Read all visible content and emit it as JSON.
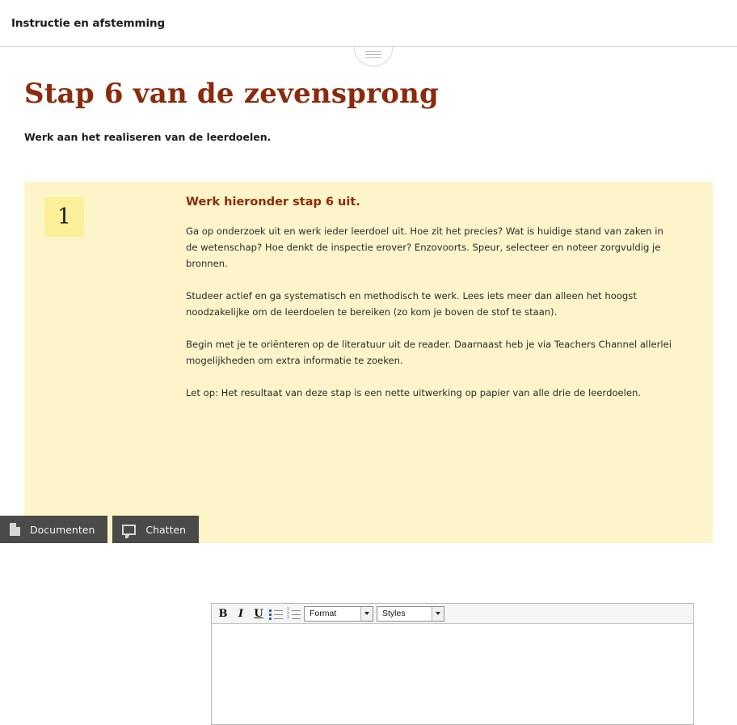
{
  "header": {
    "title": "Instructie en afstemming",
    "drag_handle_icon": "grip-lines-icon"
  },
  "page": {
    "title": "Stap 6 van de zevensprong",
    "subtitle": "Werk aan het realiseren van de leerdoelen."
  },
  "task_panel": {
    "number": "1",
    "heading": "Werk hieronder stap 6 uit.",
    "paragraphs": [
      "Ga op onderzoek uit en werk ieder leerdoel uit. Hoe zit het precies? Wat is huidige stand van zaken in de wetenschap? Hoe denkt de inspectie erover? Enzovoorts. Speur, selecteer en noteer zorgvuldig je bronnen.",
      "Studeer actief en ga systematisch en methodisch te werk. Lees iets meer dan alleen het hoogst noodzakelijke om de leerdoelen te bereiken (zo kom je boven de stof te staan).",
      "Begin met je te oriënteren op de literatuur uit de reader. Daarnaast heb je via Teachers Channel allerlei mogelijkheden om extra informatie te zoeken.",
      "Let op: Het resultaat van deze stap is een nette uitwerking op papier van alle drie de leerdoelen."
    ]
  },
  "editor": {
    "toolbar": {
      "bold_label": "B",
      "italic_label": "I",
      "underline_label": "U",
      "bulleted_list_icon": "bulleted-list-icon",
      "numbered_list_icon": "numbered-list-icon",
      "format_select_value": "Format",
      "styles_select_value": "Styles"
    },
    "content": ""
  },
  "taskbar": {
    "buttons": [
      {
        "label": "Documenten",
        "icon": "document-icon"
      },
      {
        "label": "Chatten",
        "icon": "chat-bubble-icon"
      }
    ]
  },
  "colors": {
    "accent_red": "#8c2a0c",
    "panel_yellow": "#fdf5c9",
    "badge_yellow": "#fdf09a",
    "taskbar_dark": "#4a4a48"
  }
}
